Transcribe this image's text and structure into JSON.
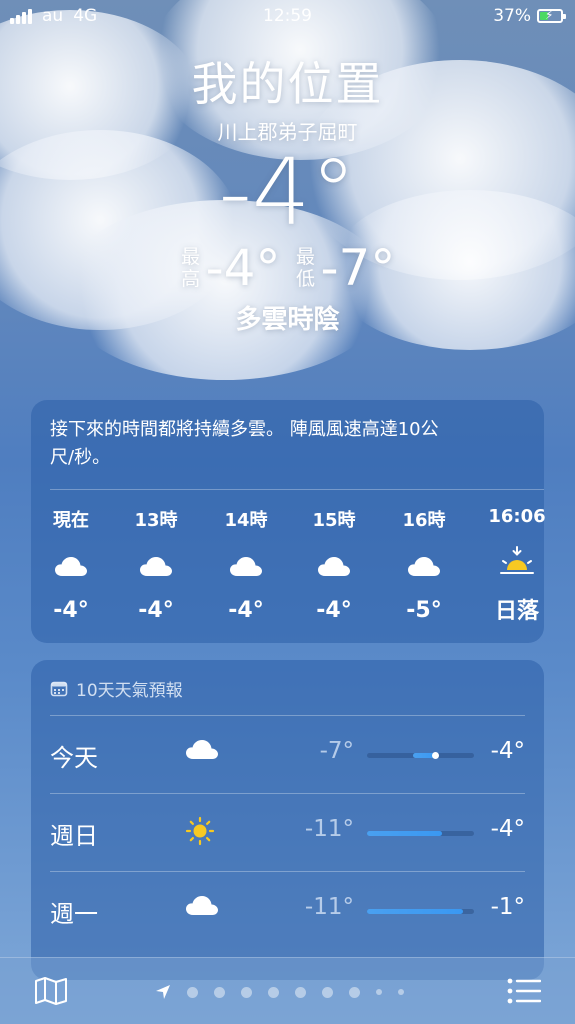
{
  "status": {
    "carrier": "au",
    "network": "4G",
    "time": "12:59",
    "battery": "37%"
  },
  "location": {
    "title": "我的位置",
    "place": "川上郡弟子屈町"
  },
  "current": {
    "temp": "-4°",
    "high_label": "最高",
    "high": "-4°",
    "low_label": "最低",
    "low": "-7°",
    "condition": "多雲時陰"
  },
  "hourly": {
    "summary": "接下來的時間都將持續多雲。 陣風風速高達10公尺/秒。",
    "items": [
      {
        "time": "現在",
        "icon": "cloud-icon",
        "temp": "-4°"
      },
      {
        "time": "13時",
        "icon": "cloud-icon",
        "temp": "-4°"
      },
      {
        "time": "14時",
        "icon": "cloud-icon",
        "temp": "-4°"
      },
      {
        "time": "15時",
        "icon": "cloud-icon",
        "temp": "-4°"
      },
      {
        "time": "16時",
        "icon": "cloud-icon",
        "temp": "-5°"
      },
      {
        "time": "16:06",
        "icon": "sunset-icon",
        "temp": "日落"
      }
    ]
  },
  "tenday": {
    "title": "10天天氣預報",
    "rows": [
      {
        "day": "今天",
        "icon": "cloud-icon",
        "low": "-7°",
        "high": "-4°",
        "range_start": 0.43,
        "range_end": 0.64,
        "current_marker": 0.64
      },
      {
        "day": "週日",
        "icon": "sun-icon",
        "low": "-11°",
        "high": "-4°",
        "range_start": 0.0,
        "range_end": 0.7
      },
      {
        "day": "週一",
        "icon": "cloud-icon",
        "low": "-11°",
        "high": "-1°",
        "range_start": 0.0,
        "range_end": 0.9
      }
    ]
  },
  "toolbar": {
    "pages": 9
  },
  "colors": {
    "sun": "#f7c922",
    "bar": "#3a98f2"
  }
}
